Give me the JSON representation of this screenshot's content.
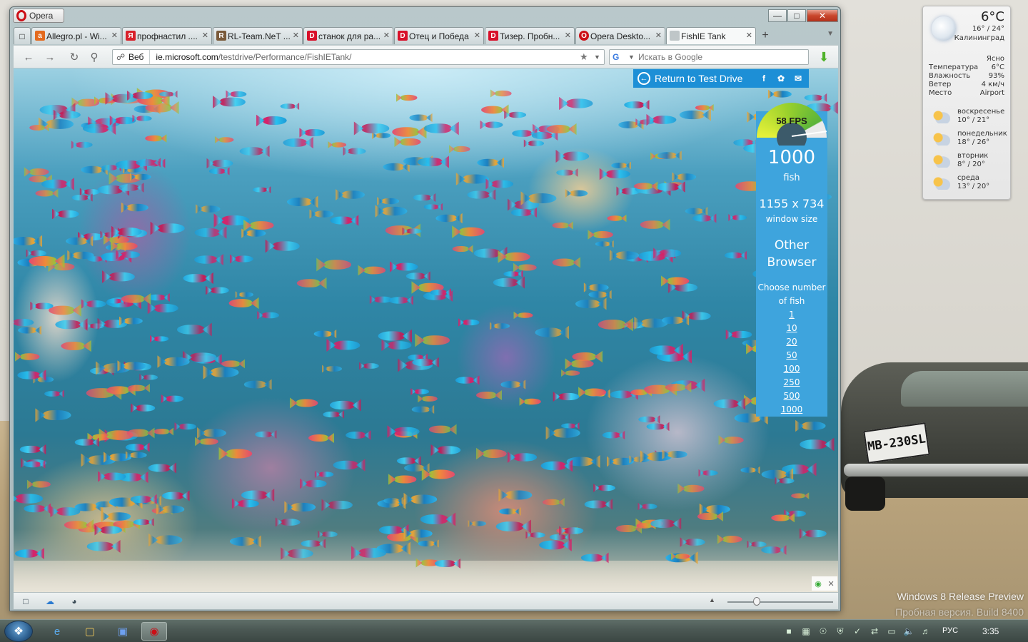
{
  "desktop": {
    "watermark_line1": "Windows 8 Release Preview",
    "watermark_line2": "Пробная версия. Build 8400",
    "plate": "MB-230SL"
  },
  "weather": {
    "temp": "6°C",
    "range": "16° / 24°",
    "city": "Калининград",
    "condition": "Ясно",
    "rows": [
      {
        "label": "Температура",
        "value": "6°C"
      },
      {
        "label": "Влажность",
        "value": "93%"
      },
      {
        "label": "Ветер",
        "value": "4 км/ч"
      },
      {
        "label": "Место",
        "value": "Airport"
      }
    ],
    "forecast": [
      {
        "day": "воскресенье",
        "range": "10° / 21°"
      },
      {
        "day": "понедельник",
        "range": "18° / 26°"
      },
      {
        "day": "вторник",
        "range": "8° / 20°"
      },
      {
        "day": "среда",
        "range": "13° / 20°"
      }
    ]
  },
  "browser": {
    "menu_label": "Opera",
    "tabs": [
      {
        "label": "Allegro.pl - Wi...",
        "fav": "a",
        "fav_color": "#e36a1e"
      },
      {
        "label": "профнастил ....",
        "fav": "Я",
        "fav_color": "#d8202a"
      },
      {
        "label": "RL-Team.NeT ...",
        "fav": "R",
        "fav_color": "#7a5a3a"
      },
      {
        "label": "станок для ра...",
        "fav": "D",
        "fav_color": "#d8102a"
      },
      {
        "label": "Отец и Победа",
        "fav": "D",
        "fav_color": "#d8102a"
      },
      {
        "label": "Тизер. Пробн...",
        "fav": "D",
        "fav_color": "#d8102a"
      },
      {
        "label": "Opera Deskto...",
        "fav": "O",
        "fav_color": "#cc0f16"
      },
      {
        "label": "FishIE Tank",
        "fav": "",
        "fav_color": "#bfc6c8"
      }
    ],
    "address": {
      "web_label": "Веб",
      "url_host": "ie.microsoft.com",
      "url_path": "/testdrive/Performance/FishIETank/"
    },
    "search_placeholder": "Искать в Google"
  },
  "page": {
    "return_link": "Return to Test Drive",
    "fps": "58 FPS",
    "fps_value": 58,
    "fish_count": "1000",
    "fish_unit": "fish",
    "window_size": "1155 x 734",
    "window_size_label": "window size",
    "browser_line1": "Other",
    "browser_line2": "Browser",
    "choose_line1": "Choose number",
    "choose_line2": "of fish",
    "options": [
      "1",
      "10",
      "20",
      "50",
      "100",
      "250",
      "500",
      "1000"
    ]
  },
  "taskbar": {
    "lang": "РУС",
    "clock": "3:35"
  },
  "colors": {
    "panel": "#3ea4dd",
    "testdrive_bar": "#1d8fd6",
    "opera_red": "#cc0f16"
  }
}
